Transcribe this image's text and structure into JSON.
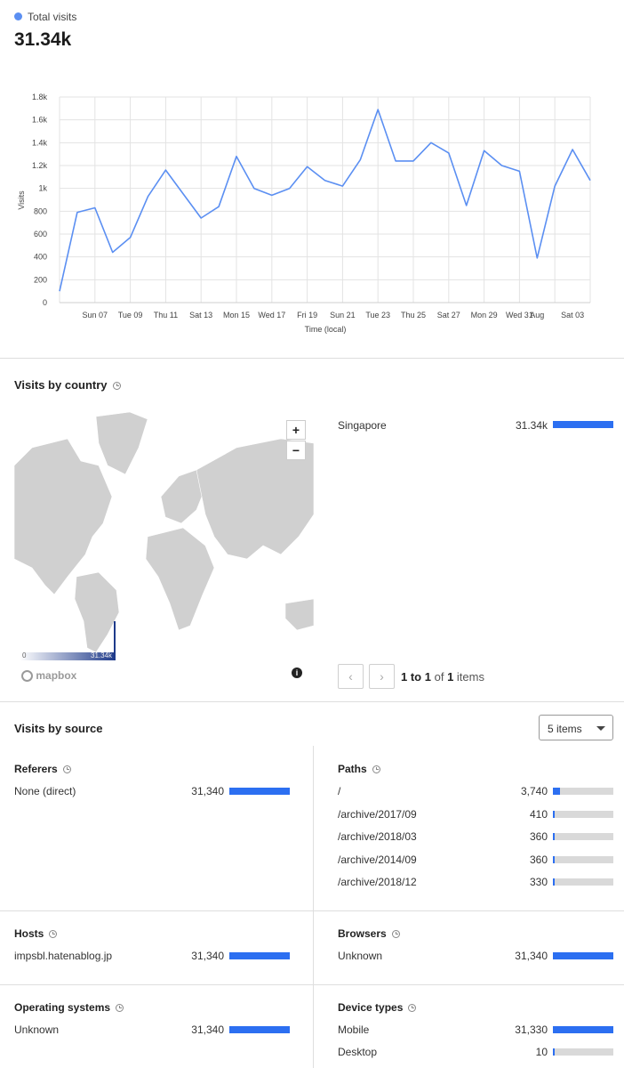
{
  "total": {
    "legend_label": "Total visits",
    "value": "31.34k",
    "series_color": "#5b8ff2"
  },
  "chart_data": {
    "type": "line",
    "ylabel": "Visits",
    "xlabel": "Time (local)",
    "ylim": [
      0,
      1800
    ],
    "yticks": [
      "0",
      "200",
      "400",
      "600",
      "800",
      "1k",
      "1.2k",
      "1.4k",
      "1.6k",
      "1.8k"
    ],
    "xtick_labels": [
      "Sun 07",
      "Tue 09",
      "Thu 11",
      "Sat 13",
      "Mon 15",
      "Wed 17",
      "Fri 19",
      "Sun 21",
      "Tue 23",
      "Thu 25",
      "Sat 27",
      "Mon 29",
      "Wed 31",
      "Aug",
      "Sat 03"
    ],
    "x": [
      "Jul 05",
      "Jul 06",
      "Jul 07",
      "Jul 08",
      "Jul 09",
      "Jul 10",
      "Jul 11",
      "Jul 12",
      "Jul 13",
      "Jul 14",
      "Jul 15",
      "Jul 16",
      "Jul 17",
      "Jul 18",
      "Jul 19",
      "Jul 20",
      "Jul 21",
      "Jul 22",
      "Jul 23",
      "Jul 24",
      "Jul 25",
      "Jul 26",
      "Jul 27",
      "Jul 28",
      "Jul 29",
      "Jul 30",
      "Jul 31",
      "Aug 01",
      "Aug 02",
      "Aug 03",
      "Aug 04"
    ],
    "values": [
      100,
      790,
      830,
      440,
      570,
      930,
      1160,
      950,
      740,
      840,
      1280,
      1000,
      940,
      1000,
      1190,
      1070,
      1020,
      1250,
      1690,
      1240,
      1240,
      1400,
      1310,
      850,
      1330,
      1200,
      1150,
      390,
      1020,
      1340,
      1070
    ],
    "grid": true,
    "legend": "top-left"
  },
  "country": {
    "title": "Visits by country",
    "rows": [
      {
        "name": "Singapore",
        "value": "31.34k",
        "fraction": 1.0
      }
    ],
    "scale_min": "0",
    "scale_max": "31.34k",
    "map_logo": "mapbox",
    "zoom_in": "+",
    "zoom_out": "−",
    "info_icon": "i",
    "pager": {
      "prev": "‹",
      "next": "›",
      "range": "1 to 1",
      "of": "of",
      "total": "1",
      "items": "items"
    }
  },
  "source": {
    "title": "Visits by source",
    "items_select": "5 items",
    "referers": {
      "title": "Referers",
      "rows": [
        {
          "name": "None (direct)",
          "value": "31,340",
          "fraction": 1.0
        }
      ]
    },
    "paths": {
      "title": "Paths",
      "rows": [
        {
          "name": "/",
          "value": "3,740",
          "fraction": 0.12
        },
        {
          "name": "/archive/2017/09",
          "value": "410",
          "fraction": 0.013
        },
        {
          "name": "/archive/2018/03",
          "value": "360",
          "fraction": 0.011
        },
        {
          "name": "/archive/2014/09",
          "value": "360",
          "fraction": 0.011
        },
        {
          "name": "/archive/2018/12",
          "value": "330",
          "fraction": 0.011
        }
      ]
    },
    "hosts": {
      "title": "Hosts",
      "rows": [
        {
          "name": "impsbl.hatenablog.jp",
          "value": "31,340",
          "fraction": 1.0
        }
      ]
    },
    "browsers": {
      "title": "Browsers",
      "rows": [
        {
          "name": "Unknown",
          "value": "31,340",
          "fraction": 1.0
        }
      ]
    },
    "os": {
      "title": "Operating systems",
      "rows": [
        {
          "name": "Unknown",
          "value": "31,340",
          "fraction": 1.0
        }
      ]
    },
    "devices": {
      "title": "Device types",
      "rows": [
        {
          "name": "Mobile",
          "value": "31,330",
          "fraction": 1.0
        },
        {
          "name": "Desktop",
          "value": "10",
          "fraction": 0.0003
        }
      ]
    }
  }
}
